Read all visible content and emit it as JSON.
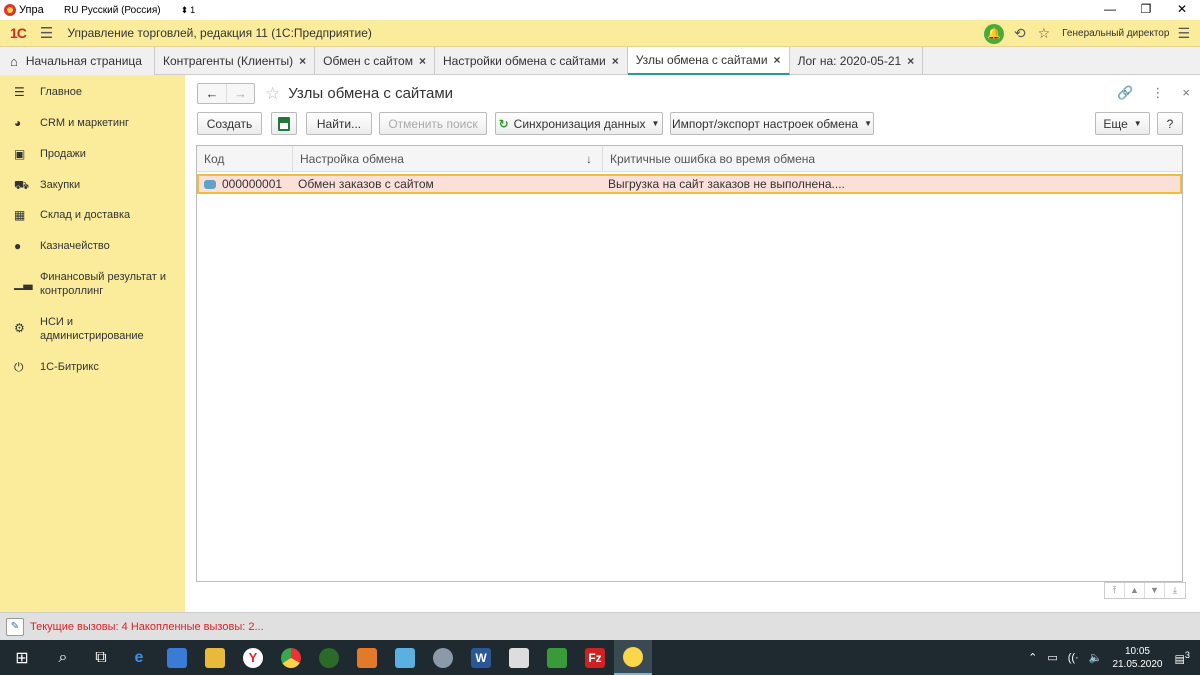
{
  "titlebar": {
    "app_title_short": "Упра",
    "language": "RU Русский (Россия)",
    "language_hint": "1",
    "minimize": "—",
    "restore": "❐",
    "close": "✕"
  },
  "appheader": {
    "logo": "1С",
    "title": "Управление торговлей, редакция 11  (1С:Предприятие)",
    "user": "Генеральный директор"
  },
  "tabs": [
    {
      "label": "Начальная страница"
    },
    {
      "label": "Контрагенты (Клиенты)"
    },
    {
      "label": "Обмен с сайтом"
    },
    {
      "label": "Настройки обмена с сайтами"
    },
    {
      "label": "Узлы обмена с сайтами"
    },
    {
      "label": "Лог на: 2020-05-21"
    }
  ],
  "sidebar": {
    "items": [
      {
        "label": "Главное",
        "icon": "list-icon"
      },
      {
        "label": "CRM и маркетинг",
        "icon": "pie-icon"
      },
      {
        "label": "Продажи",
        "icon": "bag-icon"
      },
      {
        "label": "Закупки",
        "icon": "cart-icon"
      },
      {
        "label": "Склад и доставка",
        "icon": "warehouse-icon"
      },
      {
        "label": "Казначейство",
        "icon": "coin-icon"
      },
      {
        "label": "Финансовый результат и контроллинг",
        "icon": "bar-chart-icon"
      },
      {
        "label": "НСИ и администрирование",
        "icon": "gear-icon"
      },
      {
        "label": "1С-Битрикс",
        "icon": "power-icon"
      }
    ]
  },
  "form": {
    "title": "Узлы обмена с сайтами",
    "toolbar": {
      "create": "Создать",
      "find": "Найти...",
      "cancel_search": "Отменить поиск",
      "sync": "Синхронизация данных",
      "import_export": "Импорт/экспорт настроек обмена",
      "more": "Еще",
      "help": "?"
    },
    "table": {
      "headers": [
        "Код",
        "Настройка обмена",
        "Критичные ошибка во время обмена"
      ],
      "rows": [
        {
          "code": "000000001",
          "setting": "Обмен заказов с сайтом",
          "error": "Выгрузка на сайт заказов не выполнена...."
        }
      ]
    }
  },
  "statusbar": {
    "text": "Текущие вызовы: 4   Накопленные вызовы: 2..."
  },
  "taskbar": {
    "time": "10:05",
    "date": "21.05.2020",
    "notifications": "3"
  }
}
